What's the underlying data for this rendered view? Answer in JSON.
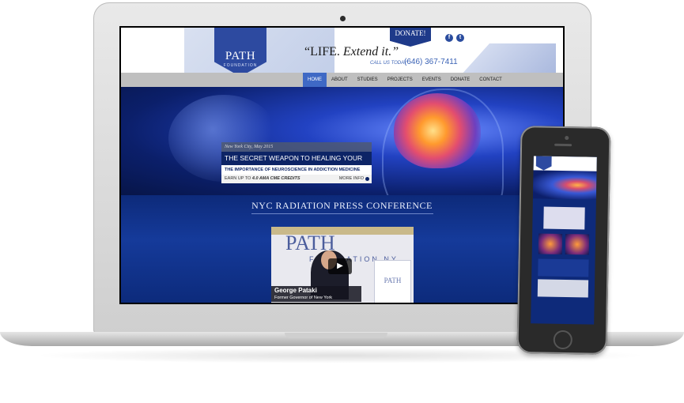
{
  "site": {
    "logo": "PATH",
    "logo_sub": "FOUNDATION",
    "tagline_start": "“LIFE.",
    "tagline_em": "Extend it.”",
    "callus": "CALL US TODAY",
    "phone": "(646) 367-7411",
    "donate_badge": "DONATE!",
    "social": [
      "f",
      "t"
    ]
  },
  "nav": {
    "items": [
      "HOME",
      "ABOUT",
      "STUDIES",
      "PROJECTS",
      "EVENTS",
      "DONATE",
      "CONTACT"
    ],
    "active": "HOME"
  },
  "hero": {
    "date": "New York City, May 2015",
    "title": "THE SECRET WEAPON TO HEALING YOUR BRAIN",
    "subtitle": "THE IMPORTANCE OF NEUROSCIENCE IN ADDICTION MEDICINE",
    "credits_prefix": "EARN UP TO ",
    "credits_em": "4.0 AMA CME CREDITS",
    "more": "MORE INFO"
  },
  "press": {
    "title": "NYC RADIATION PRESS CONFERENCE",
    "video": {
      "logo": "PATH",
      "foundation": "FOUNDATION NY",
      "panel": "PATH",
      "caption_name": "George Pataki",
      "caption_role": "Former Governor of New York"
    }
  },
  "colors": {
    "brand_blue": "#2d4aa0",
    "nav_active": "#3f69c5",
    "hero_dark": "#0b1f6a"
  }
}
